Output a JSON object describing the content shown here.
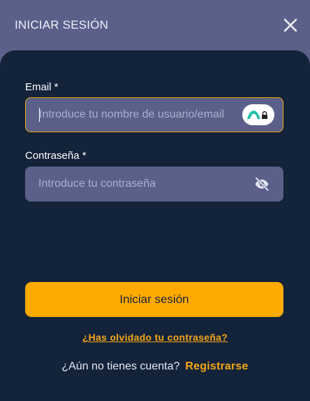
{
  "header": {
    "title": "INICIAR SESIÓN",
    "close_icon": "close-icon"
  },
  "form": {
    "email": {
      "label": "Email *",
      "placeholder": "Introduce tu nombre de usuario/email",
      "value": "",
      "focused": true,
      "addon_icon": "password-manager-icon"
    },
    "password": {
      "label": "Contraseña *",
      "placeholder": "Introduce tu contraseña",
      "value": "",
      "toggle_icon": "eye-slash-icon"
    },
    "submit_label": "Iniciar sesión",
    "forgot_label": "¿Has olvidado tu contraseña?"
  },
  "register": {
    "question": "¿Aún no tienes cuenta?",
    "link_label": "Registrarse"
  },
  "colors": {
    "header_bg": "#5a6089",
    "panel_bg": "#13233a",
    "input_bg": "#5a6089",
    "accent": "#ffaa00",
    "link": "#f5a716"
  }
}
